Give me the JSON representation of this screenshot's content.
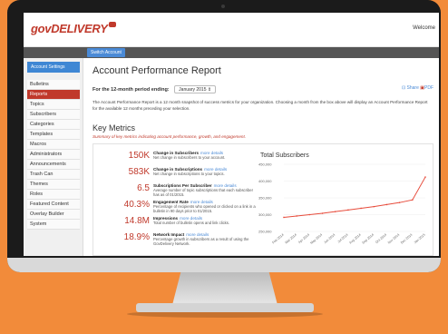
{
  "header": {
    "logo_text": "govDELIVERY",
    "welcome": "Welcome",
    "switch_account": "Switch Account"
  },
  "sidebar": {
    "account_settings": "Account Settings",
    "items": [
      {
        "label": "Bulletins"
      },
      {
        "label": "Reports"
      },
      {
        "label": "Topics"
      },
      {
        "label": "Subscribers"
      },
      {
        "label": "Categories"
      },
      {
        "label": "Templates"
      },
      {
        "label": "Macros"
      },
      {
        "label": "Administrators"
      },
      {
        "label": "Announcements"
      },
      {
        "label": "Trash Can"
      },
      {
        "label": "Themes"
      },
      {
        "label": "Roles"
      },
      {
        "label": "Featured Content"
      },
      {
        "label": "Overlay Builder"
      },
      {
        "label": "System"
      }
    ],
    "active_index": 1
  },
  "main": {
    "title": "Account Performance Report",
    "period_label": "For the 12-month period ending:",
    "period_value": "January 2015",
    "share": "Share",
    "pdf": "PDF",
    "description": "The Account Performance Report is a 12 month snapshot of success metrics for your organization. Choosing a month from the box above will display an Account Performance Report for the available 12 months preceding your selection.",
    "key_metrics_title": "Key Metrics",
    "key_metrics_sub": "Summary of key metrics indicating account performance, growth, and engagement.",
    "more_details": "more details",
    "metrics": [
      {
        "value": "150K",
        "label": "Change in Subscribers",
        "desc": "Net change in subscribers to your account."
      },
      {
        "value": "583K",
        "label": "Change in Subscriptions",
        "desc": "Net change in subscriptions to your topics."
      },
      {
        "value": "6.5",
        "label": "Subscriptions Per Subscriber",
        "desc": "Average number of topic subscriptions that each subscriber has as of 01/2015."
      },
      {
        "value": "40.3%",
        "label": "Engagement Rate",
        "desc": "Percentage of recipients who opened or clicked on a link in a bulletin in 90 days prior to 01/2015."
      },
      {
        "value": "14.8M",
        "label": "Impressions",
        "desc": "Total number of bulletin opens and link clicks."
      },
      {
        "value": "18.9%",
        "label": "Network Impact",
        "desc": "Percentage growth in subscribers as a result of using the GovDelivery Network."
      }
    ]
  },
  "chart_data": {
    "type": "line",
    "title": "Total Subscribers",
    "x": [
      "Feb 2014",
      "Mar 2014",
      "Apr 2014",
      "May 2014",
      "Jun 2014",
      "Jul 2014",
      "Aug 2014",
      "Sep 2014",
      "Oct 2014",
      "Nov 2014",
      "Dec 2014",
      "Jan 2015"
    ],
    "series": [
      {
        "values": [
          292000,
          296000,
          300000,
          304000,
          309000,
          314000,
          319000,
          324000,
          330000,
          336000,
          344000,
          412000
        ]
      }
    ],
    "y_ticks": [
      "250,000",
      "300,000",
      "350,000",
      "400,000",
      "450,000"
    ],
    "ylim": [
      250000,
      450000
    ],
    "line_color": "#e74c3c",
    "grid": true
  }
}
